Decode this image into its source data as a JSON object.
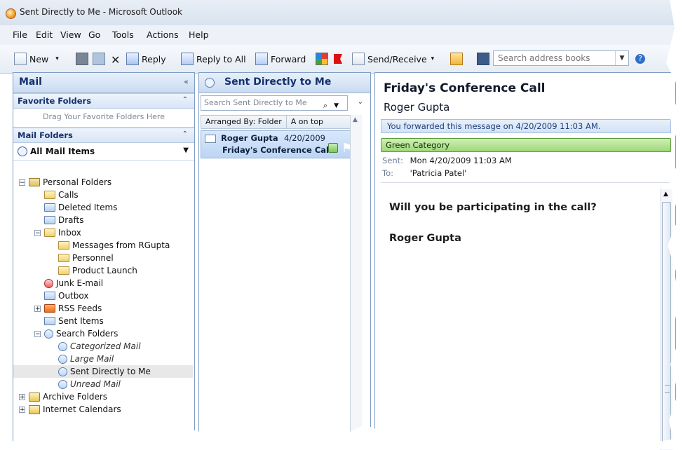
{
  "window": {
    "title": "Sent Directly to Me - Microsoft Outlook"
  },
  "menu": [
    "File",
    "Edit",
    "View",
    "Go",
    "Tools",
    "Actions",
    "Help"
  ],
  "toolbar": {
    "new": "New",
    "reply": "Reply",
    "reply_all": "Reply to All",
    "forward": "Forward",
    "send_receive": "Send/Receive",
    "search_placeholder": "Search address books"
  },
  "nav": {
    "title": "Mail",
    "favorites_header": "Favorite Folders",
    "favorites_hint": "Drag Your Favorite Folders Here",
    "mail_folders_header": "Mail Folders",
    "all_mail": "All Mail Items",
    "tree": [
      {
        "label": "Personal Folders",
        "level": 0,
        "expanded": true,
        "icon": "personal-folders-icon"
      },
      {
        "label": "Calls",
        "level": 1,
        "icon": "folder-icon"
      },
      {
        "label": "Deleted Items",
        "level": 1,
        "icon": "deleted-items-icon"
      },
      {
        "label": "Drafts",
        "level": 1,
        "icon": "drafts-icon"
      },
      {
        "label": "Inbox",
        "level": 1,
        "expanded": true,
        "icon": "inbox-icon"
      },
      {
        "label": "Messages from RGupta",
        "level": 2,
        "icon": "folder-icon"
      },
      {
        "label": "Personnel",
        "level": 2,
        "icon": "folder-icon"
      },
      {
        "label": "Product Launch",
        "level": 2,
        "icon": "folder-icon"
      },
      {
        "label": "Junk E-mail",
        "level": 1,
        "icon": "junk-email-icon"
      },
      {
        "label": "Outbox",
        "level": 1,
        "icon": "outbox-icon"
      },
      {
        "label": "RSS Feeds",
        "level": 1,
        "expanded": false,
        "icon": "rss-icon"
      },
      {
        "label": "Sent Items",
        "level": 1,
        "icon": "sent-items-icon"
      },
      {
        "label": "Search Folders",
        "level": 1,
        "expanded": true,
        "icon": "search-folder-icon"
      },
      {
        "label": "Categorized Mail",
        "level": 2,
        "icon": "search-folder-icon",
        "italic": true
      },
      {
        "label": "Large Mail",
        "level": 2,
        "icon": "search-folder-icon",
        "italic": true
      },
      {
        "label": "Sent Directly to Me",
        "level": 2,
        "icon": "search-folder-icon",
        "selected": true
      },
      {
        "label": "Unread Mail",
        "level": 2,
        "icon": "search-folder-icon",
        "italic": true
      },
      {
        "label": "Archive Folders",
        "level": 0,
        "expanded": false,
        "icon": "archive-folders-icon"
      },
      {
        "label": "Internet Calendars",
        "level": 0,
        "expanded": false,
        "icon": "internet-calendars-icon"
      }
    ]
  },
  "list": {
    "title": "Sent Directly to Me",
    "search_placeholder": "Search Sent Directly to Me",
    "arranged_by": "Arranged By: Folder",
    "order": "A on top",
    "messages": [
      {
        "from": "Roger Gupta",
        "date": "4/20/2009",
        "subject": "Friday's Conference Call"
      }
    ]
  },
  "reading": {
    "subject": "Friday's Conference Call",
    "sender": "Roger Gupta",
    "info": "You forwarded this message on 4/20/2009 11:03 AM.",
    "category": "Green Category",
    "sent_label": "Sent:",
    "sent_value": "Mon 4/20/2009 11:03 AM",
    "to_label": "To:",
    "to_value": "'Patricia Patel'",
    "body_line1": "Will you be participating in the call?",
    "body_line2": "Roger Gupta"
  },
  "colors": {
    "pane_border": "#7f9cc4",
    "header_blue": "#15306b",
    "green_category": "#9fd77a",
    "selected_row": "#bcd5f4"
  }
}
